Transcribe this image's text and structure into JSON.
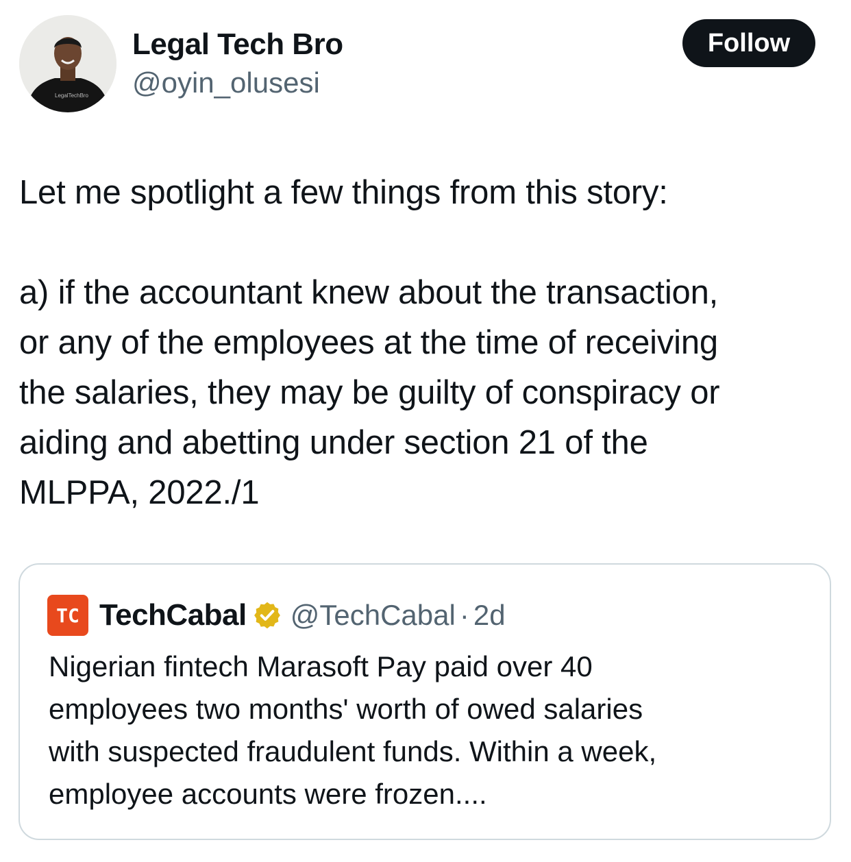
{
  "author": {
    "display_name": "Legal Tech Bro",
    "handle": "@oyin_olusesi",
    "avatar_shirt_text": "LegalTechBro"
  },
  "follow_label": "Follow",
  "tweet": {
    "lines": [
      "Let me spotlight a few things from this story:",
      "",
      "a) if the accountant knew about the transaction,",
      "or any of the employees at the time of receiving",
      "the salaries, they may be guilty of conspiracy or",
      "aiding and abetting under section 21 of the",
      "MLPPA, 2022./1"
    ]
  },
  "quote": {
    "logo_text": "TC",
    "name": "TechCabal",
    "handle": "@TechCabal",
    "separator": "·",
    "time": "2d",
    "verified_icon": "gold-verified-badge",
    "lines": [
      "Nigerian fintech Marasoft Pay paid over 40",
      "employees two months' worth of owed salaries",
      "with suspected fraudulent funds. Within a week,",
      "employee accounts were frozen...."
    ]
  },
  "colors": {
    "text": "#0f1419",
    "secondary": "#536471",
    "border": "#cfd9de",
    "follow_bg": "#0f1419",
    "logo_bg": "#e8491d",
    "verified": "#e2b719"
  }
}
